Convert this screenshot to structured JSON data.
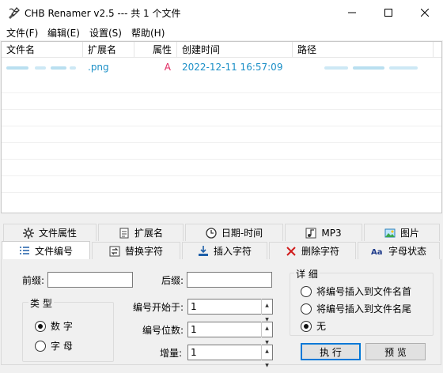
{
  "window": {
    "title": "CHB Renamer v2.5 --- 共 1 个文件",
    "app_icon": "ribbon-pen-icon",
    "controls": [
      "minimize-icon",
      "maximize-icon",
      "close-icon"
    ]
  },
  "menu": {
    "file": "文件(F)",
    "edit": "编辑(E)",
    "settings": "设置(S)",
    "help": "帮助(H)"
  },
  "table": {
    "columns": [
      "文件名",
      "扩展名",
      "属性",
      "创建时间",
      "路径"
    ],
    "rows": [
      {
        "name": "",
        "ext": ".png",
        "attr": "A",
        "created": "2022-12-11 16:57:09",
        "path": ""
      }
    ],
    "text_color": "#1b8fc7",
    "attr_color": "#e0245e"
  },
  "tabs_row1": [
    {
      "label": "文件属性",
      "icon": "gear-icon"
    },
    {
      "label": "扩展名",
      "icon": "document-icon"
    },
    {
      "label": "日期-时间",
      "icon": "clock-icon"
    },
    {
      "label": "MP3",
      "icon": "music-note-icon"
    },
    {
      "label": "图片",
      "icon": "picture-icon"
    }
  ],
  "tabs_row2": [
    {
      "label": "文件编号",
      "icon": "numbered-list-icon",
      "active": true
    },
    {
      "label": "替换字符",
      "icon": "replace-icon"
    },
    {
      "label": "插入字符",
      "icon": "insert-arrow-icon"
    },
    {
      "label": "删除字符",
      "icon": "delete-x-icon"
    },
    {
      "label": "字母状态",
      "icon": "letter-case-icon"
    }
  ],
  "numbering": {
    "prefix_label": "前缀:",
    "prefix_value": "",
    "suffix_label": "后缀:",
    "suffix_value": "",
    "type_group": "类 型",
    "type_digit": "数 字",
    "type_letter": "字 母",
    "type_selected": "数 字",
    "start_label": "编号开始于:",
    "start_value": "1",
    "digits_label": "编号位数:",
    "digits_value": "1",
    "increment_label": "增量:",
    "increment_value": "1",
    "detail_group": "详 细",
    "opt_head": "将编号插入到文件名首",
    "opt_tail": "将编号插入到文件名尾",
    "opt_none": "无",
    "opt_selected": "无",
    "execute_button": "执 行",
    "preview_button": "预 览"
  }
}
